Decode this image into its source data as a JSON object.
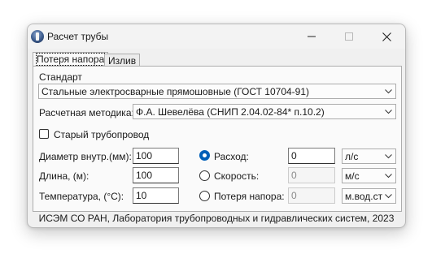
{
  "window": {
    "title": "Расчет трубы"
  },
  "tabs": [
    {
      "label": "Потеря напора"
    },
    {
      "label": "Излив"
    }
  ],
  "standard": {
    "label": "Стандарт",
    "value": "Стальные электросварные прямошовные (ГОСТ 10704-91)"
  },
  "method": {
    "label": "Расчетная методика:",
    "value": "Ф.А. Шевелёва (СНИП 2.04.02-84* п.10.2)"
  },
  "old_pipe": {
    "label": "Старый трубопровод",
    "checked": false
  },
  "params": [
    {
      "label": "Диаметр внутр.(мм):",
      "value": "100"
    },
    {
      "label": "Длина, (м):",
      "value": "100"
    },
    {
      "label": "Температура, (°С):",
      "value": "10"
    }
  ],
  "results": [
    {
      "label": "Расход:",
      "value": "0",
      "unit": "л/с",
      "selected": true
    },
    {
      "label": "Скорость:",
      "value": "0",
      "unit": "м/с",
      "selected": false
    },
    {
      "label": "Потеря напора:",
      "value": "0",
      "unit": "м.вод.ст",
      "selected": false
    }
  ],
  "footer": "ИСЭМ СО РАН, Лаборатория трубопроводных и гидравлических систем,  2023"
}
